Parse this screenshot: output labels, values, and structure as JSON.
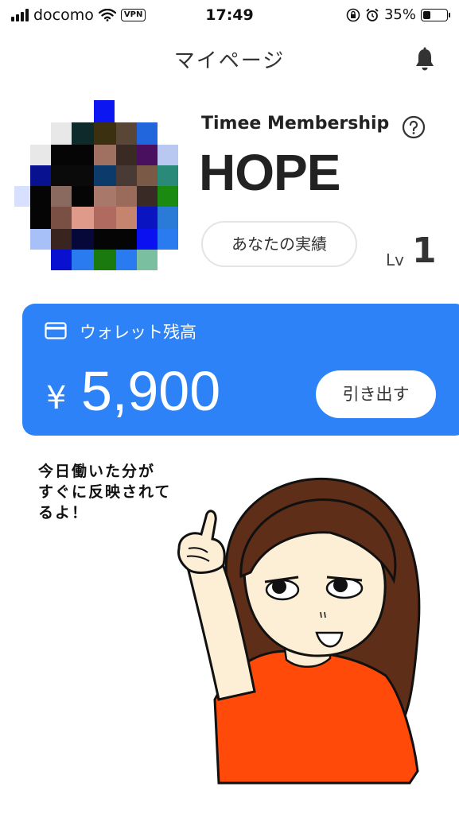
{
  "status_bar": {
    "carrier": "docomo",
    "vpn": "VPN",
    "time": "17:49",
    "battery": "35%",
    "battery_level": 0.35
  },
  "header": {
    "title": "マイページ",
    "notification_icon": "bell-icon"
  },
  "profile": {
    "membership": "Timee Membership",
    "help_icon": "question-circle-icon",
    "rank": "HOPE",
    "results_button": "あなたの実績",
    "level_label": "Lv",
    "level_value": "1"
  },
  "wallet": {
    "icon": "card-icon",
    "label": "ウォレット残高",
    "currency": "¥",
    "amount": "5,900",
    "withdraw_button": "引き出す",
    "color": "#2d82f7"
  },
  "illustration": {
    "speech": "今日働いた分が\nすぐに反映されて\nるよ！"
  }
}
